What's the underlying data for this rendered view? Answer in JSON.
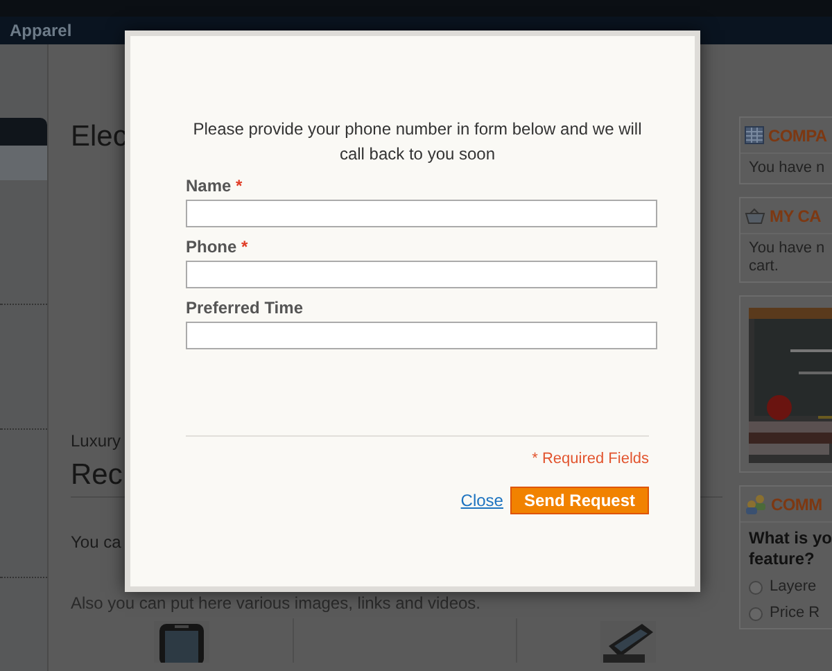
{
  "nav": {
    "item": "Apparel"
  },
  "content": {
    "heading": "Elec",
    "line": "Luxury",
    "section_heading": "Rec",
    "text_1": "You ca",
    "text_2": "Also you can put here various images, links and videos."
  },
  "right_column": {
    "compare": {
      "title": "COMPA",
      "lines": [
        "You have n"
      ]
    },
    "cart": {
      "title": "MY CA",
      "lines": [
        "You have n",
        "cart."
      ]
    },
    "poll": {
      "title": "COMM",
      "question": [
        "What is yo",
        "feature?"
      ],
      "options": [
        {
          "label": "Layere",
          "selected": false
        },
        {
          "label": "Price R",
          "selected": false
        }
      ]
    }
  },
  "modal": {
    "message": "Please provide your phone number in form below and we will call back to you soon",
    "fields": [
      {
        "label": "Name",
        "required_mark": "*"
      },
      {
        "label": "Phone",
        "required_mark": "*"
      },
      {
        "label": "Preferred Time"
      }
    ],
    "required_note": "* Required Fields",
    "close": "Close",
    "submit": "Send Request"
  }
}
